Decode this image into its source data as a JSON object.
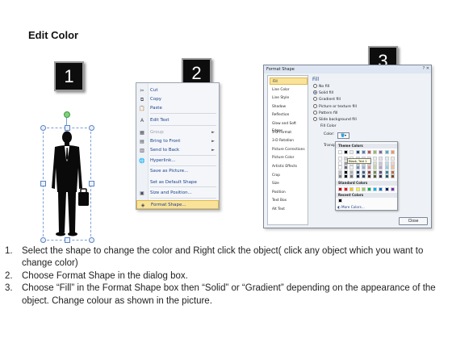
{
  "title": "Edit Color",
  "steps": [
    "1",
    "2",
    "3"
  ],
  "context_menu": {
    "items": [
      {
        "label": "Cut",
        "icon": "scissors-icon",
        "glyph": "✂",
        "state": "normal",
        "submenu": false
      },
      {
        "label": "Copy",
        "icon": "copy-icon",
        "glyph": "⧉",
        "state": "normal",
        "submenu": false
      },
      {
        "label": "Paste",
        "icon": "paste-icon",
        "glyph": "📋",
        "state": "normal",
        "submenu": false
      },
      {
        "label": "Edit Text",
        "icon": "edit-text-icon",
        "glyph": "A",
        "state": "normal",
        "submenu": false
      },
      {
        "label": "Group",
        "icon": "group-icon",
        "glyph": "▦",
        "state": "disabled",
        "submenu": true
      },
      {
        "label": "Bring to Front",
        "icon": "bring-to-front-icon",
        "glyph": "▤",
        "state": "normal",
        "submenu": true
      },
      {
        "label": "Send to Back",
        "icon": "send-to-back-icon",
        "glyph": "▥",
        "state": "normal",
        "submenu": true
      },
      {
        "label": "Hyperlink...",
        "icon": "hyperlink-icon",
        "glyph": "🌐",
        "state": "normal",
        "submenu": false
      },
      {
        "label": "Save as Picture...",
        "icon": "",
        "glyph": "",
        "state": "normal",
        "submenu": false
      },
      {
        "label": "Set as Default Shape",
        "icon": "",
        "glyph": "",
        "state": "normal",
        "submenu": false
      },
      {
        "label": "Size and Position...",
        "icon": "size-position-icon",
        "glyph": "▣",
        "state": "normal",
        "submenu": false
      },
      {
        "label": "Format Shape...",
        "icon": "format-shape-icon",
        "glyph": "◈",
        "state": "highlighted",
        "submenu": false
      }
    ]
  },
  "dialog": {
    "title": "Format Shape",
    "window_controls": "? ✕",
    "nav_items": [
      "Fill",
      "Line Color",
      "Line Style",
      "Shadow",
      "Reflection",
      "Glow and Soft Edges",
      "3-D Format",
      "3-D Rotation",
      "Picture Corrections",
      "Picture Color",
      "Artistic Effects",
      "Crop",
      "Size",
      "Position",
      "Text Box",
      "Alt Text"
    ],
    "selected_nav": "Fill",
    "section_title": "Fill",
    "fill_options": [
      {
        "label": "No fill",
        "selected": false
      },
      {
        "label": "Solid fill",
        "selected": true
      },
      {
        "label": "Gradient fill",
        "selected": false
      },
      {
        "label": "Picture or texture fill",
        "selected": false
      },
      {
        "label": "Pattern fill",
        "selected": false
      },
      {
        "label": "Slide background fill",
        "selected": false
      }
    ],
    "fill_color_label": "Fill Color",
    "color_label": "Color:",
    "transparency_label": "Transpa",
    "close_label": "Close"
  },
  "color_picker": {
    "theme_colors_label": "Theme Colors",
    "tooltip": "Black, Text 1",
    "standard_colors_label": "Standard Colors",
    "recent_colors_label": "Recent Colors",
    "more_colors_label": "More Colors...",
    "theme_top": [
      "#ffffff",
      "#000000",
      "#eeece1",
      "#1f497d",
      "#4f81bd",
      "#c0504d",
      "#9bbb59",
      "#8064a2",
      "#4bacc6",
      "#f79646"
    ],
    "standard": [
      "#c00000",
      "#ff0000",
      "#ffc000",
      "#ffff00",
      "#92d050",
      "#00b050",
      "#00b0f0",
      "#0070c0",
      "#002060",
      "#7030a0"
    ],
    "recent": [
      "#000000"
    ]
  },
  "instructions": [
    {
      "num": "1.",
      "text": "Select the shape to change the color and Right click the object( click any object which you want to change color)"
    },
    {
      "num": "2.",
      "text": "Choose Format Shape in the dialog box."
    },
    {
      "num": "3.",
      "text": "Choose “Fill” in the Format Shape box then “Solid” or “Gradient” depending on the appearance of the object. Change colour as shown in the picture."
    }
  ]
}
